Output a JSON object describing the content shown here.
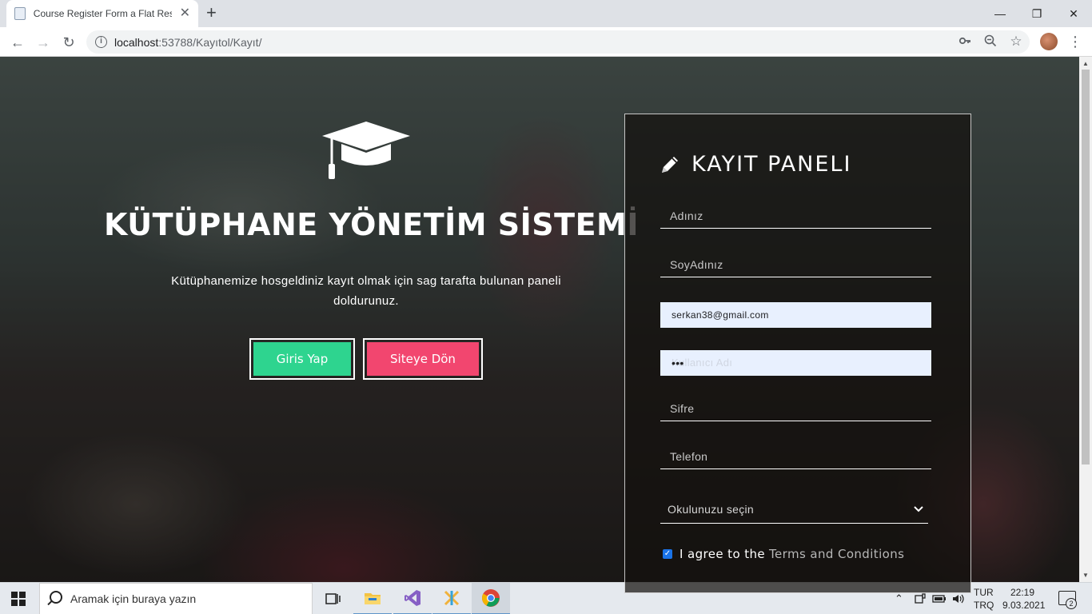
{
  "browser": {
    "tab_title": "Course Register Form a Flat Resp",
    "url_host": "localhost",
    "url_path": ":53788/Kayıtol/Kayıt/"
  },
  "hero": {
    "title": "KÜTÜPHANE YÖNETİM SİSTEMİ",
    "text": "Kütüphanemize hosgeldiniz kayıt olmak için sag tarafta bulunan paneli doldurunuz.",
    "login_button": "Giris Yap",
    "home_button": "Siteye Dön"
  },
  "panel": {
    "title": "KAYIT PANELI",
    "fields": {
      "first_name_placeholder": "Adınız",
      "last_name_placeholder": "SoyAdınız",
      "email_value": "serkan38@gmail.com",
      "username_placeholder": "Kullanıcı Adı",
      "username_value": "•••",
      "password_placeholder": "Sifre",
      "phone_placeholder": "Telefon"
    },
    "school_select": "Okulunuzu seçin",
    "agree_text": "I agree to the",
    "terms_link": "Terms and Conditions",
    "agree_checked": true
  },
  "taskbar": {
    "search_placeholder": "Aramak için buraya yazın",
    "lang_top": "TUR",
    "lang_bottom": "TRQ",
    "time": "22:19",
    "date": "9.03.2021",
    "notification_count": "2"
  },
  "colors": {
    "login_button": "#2ed48f",
    "home_button": "#f2466f",
    "autofill_bg": "#e8f0fe"
  }
}
